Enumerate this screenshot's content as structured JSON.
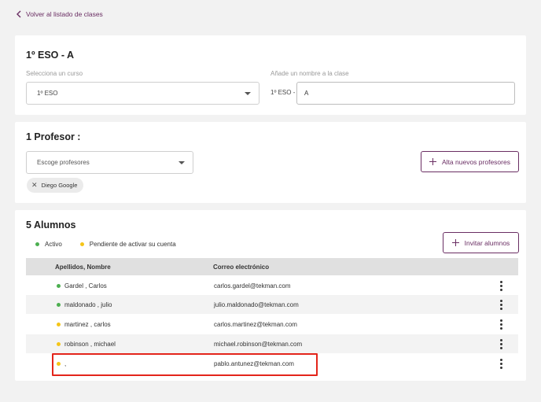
{
  "nav": {
    "back_label": "Volver al listado de clases"
  },
  "class_card": {
    "title": "1º ESO - A",
    "course_label": "Selecciona un curso",
    "course_value": "1º ESO",
    "name_label": "Añade un nombre a la clase",
    "name_prefix": "1º ESO -",
    "name_value": "A"
  },
  "teachers_card": {
    "title": "1 Profesor :",
    "select_placeholder": "Escoge profesores",
    "add_button": "Alta nuevos profesores",
    "chips": [
      {
        "label": "Diego Google"
      }
    ]
  },
  "students_card": {
    "title": "5 Alumnos",
    "legend": [
      {
        "label": "Activo",
        "color": "#4caf50"
      },
      {
        "label": "Pendiente de activar su cuenta",
        "color": "#f5c518"
      }
    ],
    "invite_button": "Invitar alumnos",
    "columns": {
      "name": "Apellidos, Nombre",
      "email": "Correo electrónico"
    },
    "rows": [
      {
        "name": "Gardel , Carlos",
        "email": "carlos.gardel@tekman.com",
        "status_color": "#4caf50"
      },
      {
        "name": "maldonado , julio",
        "email": "julio.maldonado@tekman.com",
        "status_color": "#4caf50"
      },
      {
        "name": "martinez , carlos",
        "email": "carlos.martinez@tekman.com",
        "status_color": "#f5c518"
      },
      {
        "name": "robinson , michael",
        "email": "michael.robinson@tekman.com",
        "status_color": "#f5c518"
      },
      {
        "name": ",",
        "email": "pablo.antunez@tekman.com",
        "status_color": "#f5c518"
      }
    ]
  },
  "colors": {
    "accent": "#6a2e63",
    "highlight": "#e3251b"
  }
}
